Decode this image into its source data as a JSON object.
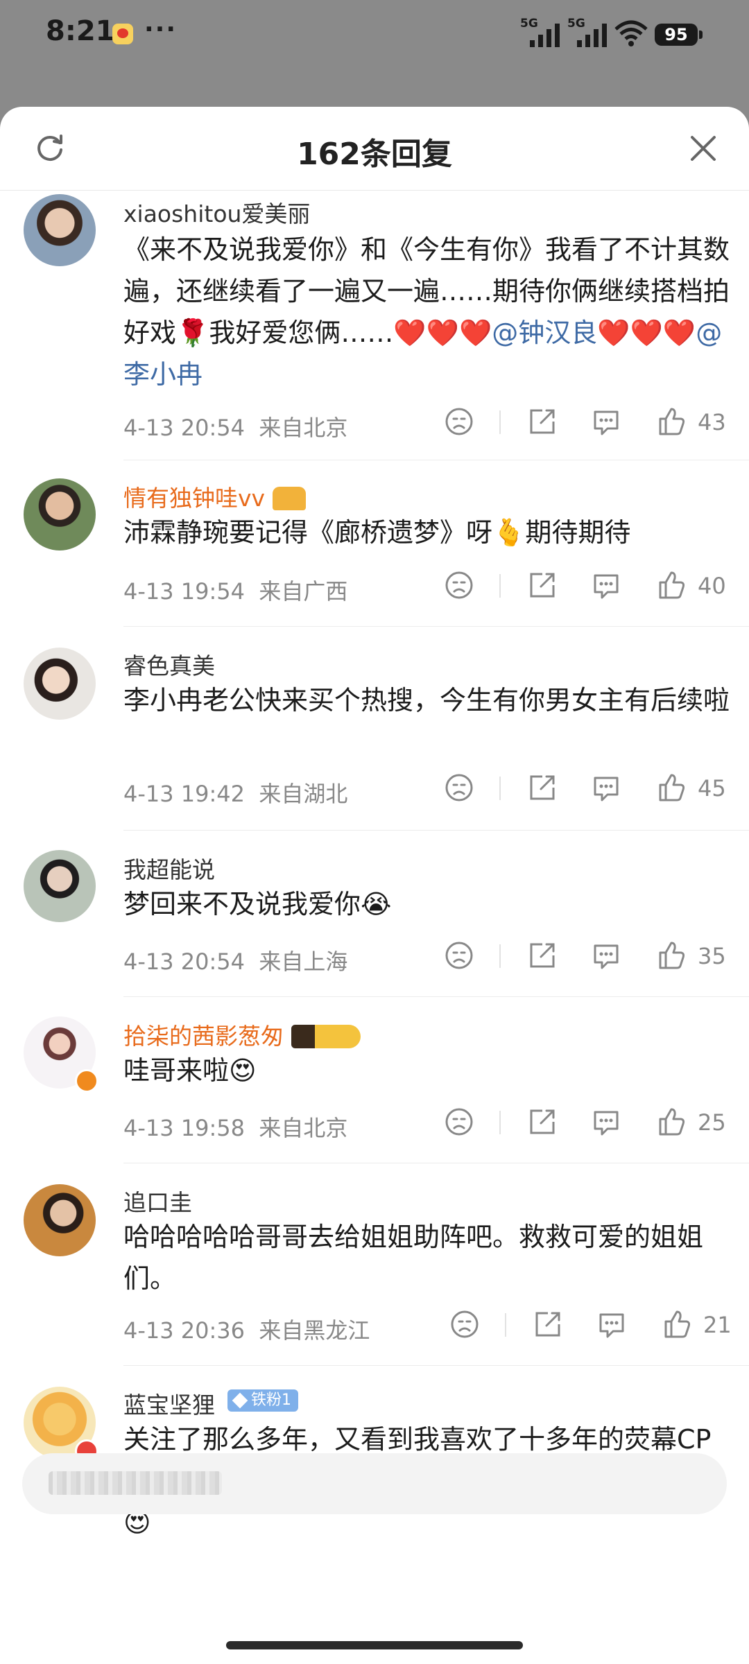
{
  "status_bar": {
    "time": "8:21",
    "more": "···",
    "signal_1_label": "5G",
    "signal_2_label": "5G",
    "battery": "95"
  },
  "sheet": {
    "title": "162条回复",
    "refresh_icon": "refresh-icon",
    "close_icon": "close-icon"
  },
  "comments": [
    {
      "user": "xiaoshitou爱美丽",
      "text_prefix": "《来不及说我爱你》和《今生有你》我看了不计其数遍，还继续看了一遍又一遍……期待你俩继续搭档拍好戏🌹我好爱您俩……❤️❤️❤️",
      "mention1": "@钟汉良",
      "text_mid": "❤️❤️❤️",
      "mention2": "@李小冉",
      "time": "4-13 20:54",
      "location": "来自北京",
      "likes": "43"
    },
    {
      "user": "情有独钟哇vv",
      "text": "沛霖静琬要记得《廊桥遗梦》呀🫰期待期待",
      "time": "4-13 19:54",
      "location": "来自广西",
      "likes": "40"
    },
    {
      "user": "睿色真美",
      "text": "李小冉老公快来买个热搜，今生有你男女主有后续啦",
      "time": "4-13 19:42",
      "location": "来自湖北",
      "likes": "45"
    },
    {
      "user": "我超能说",
      "text": "梦回来不及说我爱你😭",
      "time": "4-13 20:54",
      "location": "来自上海",
      "likes": "35"
    },
    {
      "user": "拾柒的茜影葱匆",
      "text": "哇哥来啦😍",
      "time": "4-13 19:58",
      "location": "来自北京",
      "likes": "25"
    },
    {
      "user": "追口圭",
      "text": "哈哈哈哈哈哥哥去给姐姐助阵吧。救救可爱的姐姐们。",
      "time": "4-13 20:36",
      "location": "来自黑龙江",
      "likes": "21"
    },
    {
      "user": "蓝宝坚狸",
      "badge": "铁粉1",
      "text": "关注了那么多年，又看到我喜欢了十多年的荧幕CP撒糖。谢谢“静婉”，谢谢“四少”，老粉好幸福😍😍😍"
    }
  ],
  "colors": {
    "accent_orange": "#e86b1c",
    "mention_blue": "#3e6aa5",
    "meta_gray": "#888888"
  }
}
